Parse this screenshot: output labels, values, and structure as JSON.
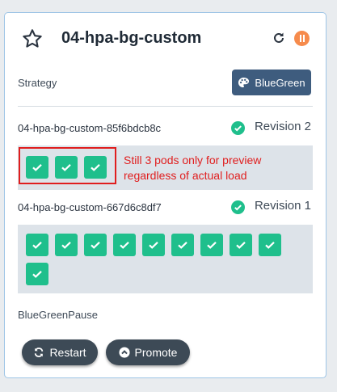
{
  "card": {
    "title": "04-hpa-bg-custom",
    "icons": {
      "favorite": "star-icon",
      "refresh": "refresh-icon",
      "status": "pause-icon"
    },
    "strategy_label": "Strategy",
    "strategy_button": "BlueGreen",
    "revisions": [
      {
        "name": "04-hpa-bg-custom-85f6bdcb8c",
        "label": "Revision 2",
        "pods": 3,
        "pod_status": "healthy"
      },
      {
        "name": "04-hpa-bg-custom-667d6c8df7",
        "label": "Revision 1",
        "pods": 10,
        "pod_status": "healthy"
      }
    ],
    "annotation": {
      "line1": "Still 3 pods only for preview",
      "line2": "regardless of actual load"
    },
    "pause_label": "BlueGreenPause",
    "buttons": {
      "restart": "Restart",
      "promote": "Promote"
    }
  },
  "colors": {
    "pod_healthy": "#1fbf8c",
    "paused": "#f68b4c",
    "strategy": "#3e5c7e",
    "annotation": "#e01e1e",
    "border": "#9ec5e6"
  }
}
